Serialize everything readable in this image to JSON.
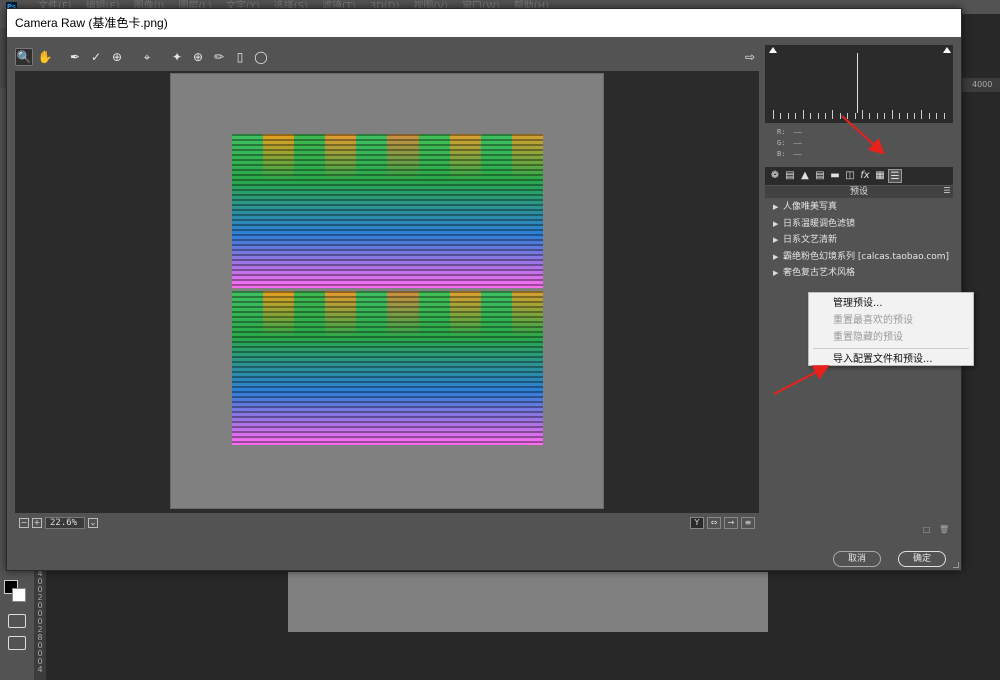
{
  "dialog": {
    "title": "Camera Raw (基准色卡.png)",
    "cancel_label": "取消",
    "ok_label": "确定"
  },
  "toolbar": {
    "tools": [
      "zoom-tool-icon",
      "hand-tool-icon",
      "white-balance-tool-icon",
      "color-sampler-tool-icon",
      "targeted-adjustment-tool-icon",
      "crop-tool-icon",
      "spot-removal-tool-icon",
      "red-eye-tool-icon",
      "adjustment-brush-icon",
      "graduated-filter-icon",
      "radial-filter-icon"
    ],
    "selected_tool": "zoom-tool-icon",
    "open_preferences_icon": "export-icon"
  },
  "statusbar": {
    "zoom_value": "22.6%",
    "view_toggle_label": "Y"
  },
  "histogram": {
    "r_label": "R:",
    "g_label": "G:",
    "b_label": "B:",
    "r_value": "——",
    "g_value": "——",
    "b_value": "——"
  },
  "panel": {
    "header": "预设",
    "active_tab": "presets-tab-icon",
    "presets": [
      "人像唯美写真",
      "日系温暖调色滤镜",
      "日系文艺清新",
      "霸绝粉色幻境系列 [calcas.taobao.com]",
      "奢色复古艺术风格"
    ]
  },
  "context_menu": {
    "items": [
      {
        "label": "管理预设...",
        "enabled": true
      },
      {
        "label": "重置最喜欢的预设",
        "enabled": false
      },
      {
        "label": "重置隐藏的预设",
        "enabled": false
      },
      {
        "label": "导入配置文件和预设...",
        "enabled": true
      }
    ]
  },
  "background": {
    "menu": [
      "文件(F)",
      "编辑(E)",
      "图像(I)",
      "图层(L)",
      "文字(Y)",
      "选择(S)",
      "滤镜(T)",
      "3D(D)",
      "视图(V)",
      "窗口(W)",
      "帮助(H)"
    ],
    "ruler_h": "4000",
    "ruler_v": [
      "4",
      "0",
      "0",
      "2",
      "0",
      "0",
      "0",
      "2",
      "8",
      "0",
      "0",
      "0",
      "4"
    ]
  },
  "colors": {
    "dialog_bg": "#535353",
    "preview_bg": "#2b2b2b",
    "document_gray": "#808080",
    "annotation_red": "#e8211c",
    "chart_hues": [
      "#40c060",
      "#e8a020",
      "#40b850",
      "#e89a30",
      "#40c060",
      "#d09040",
      "#44c058",
      "#e0a030",
      "#40c060",
      "#d8a030"
    ]
  }
}
